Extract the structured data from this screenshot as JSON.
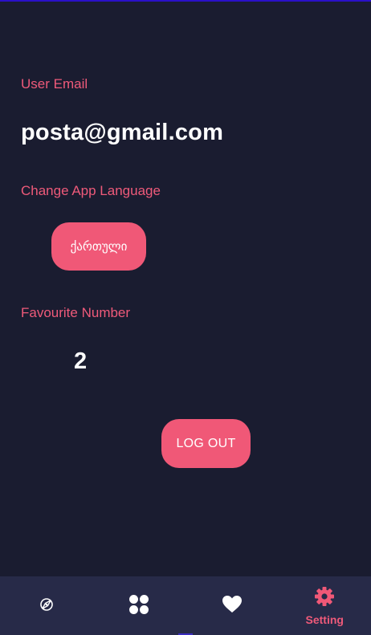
{
  "settings": {
    "email_label": "User Email",
    "email_value": "posta@gmail.com",
    "language_label": "Change App Language",
    "language_button": "ქართული",
    "favourite_label": "Favourite Number",
    "favourite_value": "2",
    "logout_button": "LOG OUT"
  },
  "nav": {
    "items": [
      {
        "icon": "compass-icon",
        "label": ""
      },
      {
        "icon": "apps-grid-icon",
        "label": ""
      },
      {
        "icon": "heart-icon",
        "label": ""
      },
      {
        "icon": "gear-icon",
        "label": "Setting",
        "active": true
      }
    ]
  },
  "colors": {
    "background": "#1a1c30",
    "accent": "#f05877",
    "nav_background": "#272a48",
    "text": "#ffffff"
  }
}
